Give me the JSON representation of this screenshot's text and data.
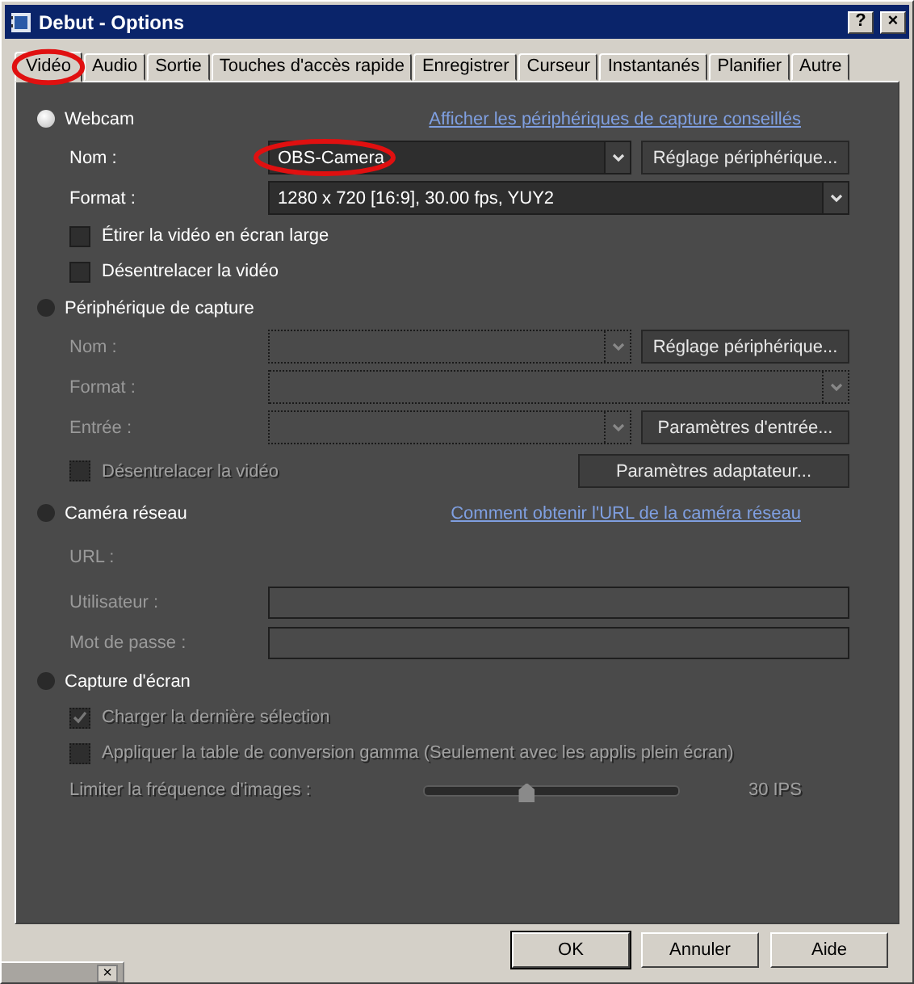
{
  "window": {
    "title": "Debut - Options",
    "buttons": [
      "?",
      "×"
    ]
  },
  "tabs": [
    {
      "label": "Vidéo",
      "selected": true,
      "annotated": true
    },
    {
      "label": "Audio",
      "selected": false
    },
    {
      "label": "Sortie",
      "selected": false
    },
    {
      "label": "Touches d'accès rapide",
      "selected": false
    },
    {
      "label": "Enregistrer",
      "selected": false
    },
    {
      "label": "Curseur",
      "selected": false
    },
    {
      "label": "Instantanés",
      "selected": false
    },
    {
      "label": "Planifier",
      "selected": false
    },
    {
      "label": "Autre",
      "selected": false
    }
  ],
  "sections": [
    {
      "label": "Webcam",
      "selected": true,
      "link": "Afficher les périphériques de capture conseillés",
      "rows": [
        {
          "kind": "combo",
          "label": "Nom :",
          "value": "OBS-Camera",
          "annotated": true,
          "disabled": false,
          "button": "Réglage périphérique..."
        },
        {
          "kind": "combo",
          "label": "Format :",
          "value": "1280 x 720 [16:9], 30.00 fps, YUY2",
          "disabled": false
        },
        {
          "kind": "checkbox",
          "label": "Étirer la vidéo en écran large",
          "checked": false,
          "disabled": false
        },
        {
          "kind": "checkbox",
          "label": "Désentrelacer la vidéo",
          "checked": false,
          "disabled": false
        }
      ]
    },
    {
      "label": "Périphérique de capture",
      "selected": false,
      "rows": [
        {
          "kind": "combo",
          "label": "Nom :",
          "disabled": true,
          "button": "Réglage périphérique..."
        },
        {
          "kind": "combo",
          "label": "Format :",
          "disabled": true
        },
        {
          "kind": "combo",
          "label": "Entrée :",
          "disabled": true,
          "button": "Paramètres d'entrée..."
        },
        {
          "kind": "checkbox",
          "label": "Désentrelacer la vidéo",
          "checked": false,
          "disabled": true,
          "button": "Paramètres adaptateur..."
        }
      ]
    },
    {
      "label": "Caméra réseau",
      "selected": false,
      "link": "Comment obtenir l'URL de la caméra réseau",
      "rows": [
        {
          "kind": "text",
          "label": "URL :",
          "disabled": true
        },
        {
          "kind": "input",
          "label": "Utilisateur :",
          "disabled": true
        },
        {
          "kind": "input",
          "label": "Mot de passe :",
          "disabled": true
        }
      ]
    },
    {
      "label": "Capture d'écran",
      "selected": false,
      "rows": [
        {
          "kind": "checkbox",
          "label": "Charger la dernière sélection",
          "checked": true,
          "disabled": true
        },
        {
          "kind": "checkbox",
          "label": "Appliquer la table de conversion gamma (Seulement avec les applis plein écran)",
          "checked": false,
          "disabled": true
        },
        {
          "kind": "slider",
          "label": "Limiter la fréquence d'images :",
          "level": 0.4,
          "reading": "30 IPS",
          "disabled": true
        }
      ]
    }
  ],
  "footer_buttons": [
    {
      "label": "OK",
      "default": true
    },
    {
      "label": "Annuler",
      "default": false
    },
    {
      "label": "Aide",
      "default": false
    }
  ],
  "minimized_window": {
    "close": "×"
  }
}
